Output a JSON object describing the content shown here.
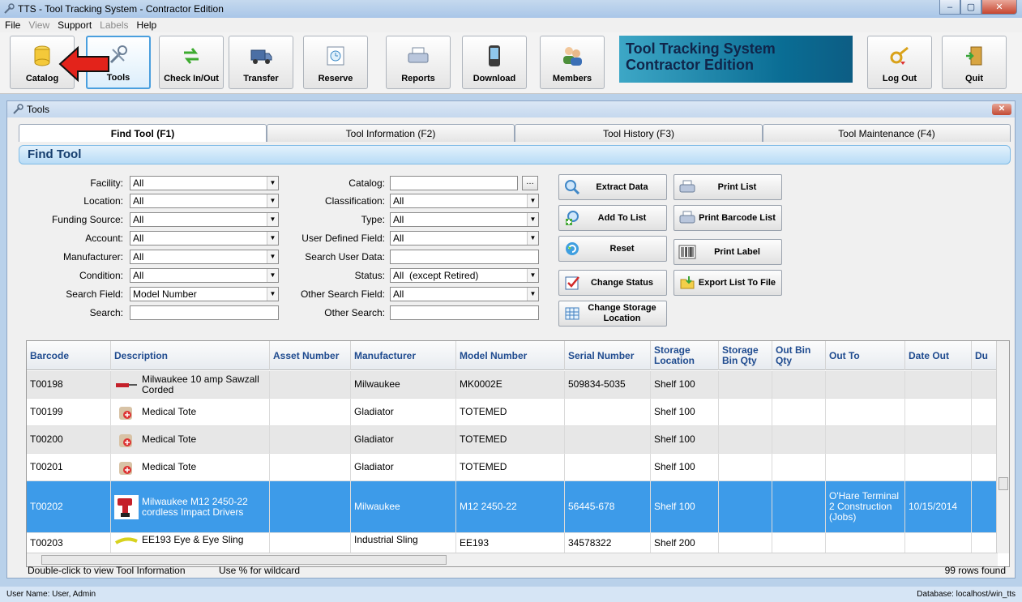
{
  "window": {
    "title": "TTS - Tool Tracking System - Contractor Edition",
    "minimize": "–",
    "maximize": "▢",
    "close": "✕"
  },
  "menu": [
    "File",
    "View",
    "Support",
    "Labels",
    "Help"
  ],
  "toolbar": {
    "buttons": [
      {
        "label": "Catalog",
        "icon": "catalog-icon"
      },
      {
        "label": "Tools",
        "icon": "tools-icon"
      },
      {
        "label": "Check In/Out",
        "icon": "check-inout-icon"
      },
      {
        "label": "Transfer",
        "icon": "transfer-icon"
      },
      {
        "label": "Reserve",
        "icon": "reserve-icon"
      },
      {
        "label": "Reports",
        "icon": "reports-icon"
      },
      {
        "label": "Download",
        "icon": "download-icon"
      },
      {
        "label": "Members",
        "icon": "members-icon"
      }
    ],
    "brand_line1": "Tool Tracking System",
    "brand_line2": "Contractor Edition",
    "logout": "Log Out",
    "quit": "Quit"
  },
  "tools_window": {
    "title": "Tools",
    "close": "✕",
    "tabs": [
      "Find Tool (F1)",
      "Tool Information (F2)",
      "Tool History (F3)",
      "Tool Maintenance (F4)"
    ],
    "section_title": "Find Tool"
  },
  "filters_left": [
    {
      "label": "Facility:",
      "value": "All"
    },
    {
      "label": "Location:",
      "value": "All"
    },
    {
      "label": "Funding Source:",
      "value": "All"
    },
    {
      "label": "Account:",
      "value": "All"
    },
    {
      "label": "Manufacturer:",
      "value": "All"
    },
    {
      "label": "Condition:",
      "value": "All"
    },
    {
      "label": "Search Field:",
      "value": "Model Number"
    },
    {
      "label": "Search:",
      "value": ""
    }
  ],
  "filters_right": [
    {
      "label": "Catalog:",
      "value": ""
    },
    {
      "label": "Classification:",
      "value": "All"
    },
    {
      "label": "Type:",
      "value": "All"
    },
    {
      "label": "User Defined Field:",
      "value": "All"
    },
    {
      "label": "Search User Data:",
      "value": ""
    },
    {
      "label": "Status:",
      "value": "All  (except Retired)"
    },
    {
      "label": "Other Search Field:",
      "value": "All"
    },
    {
      "label": "Other Search:",
      "value": ""
    }
  ],
  "actions_a": [
    {
      "label": "Extract Data",
      "icon": "magnifier-icon"
    },
    {
      "label": "Add To List",
      "icon": "add-list-icon"
    },
    {
      "label": "Reset",
      "icon": "refresh-icon"
    },
    {
      "label": "Change Status",
      "icon": "checkbox-icon"
    },
    {
      "label": "Change Storage Location",
      "icon": "grid-icon"
    }
  ],
  "actions_b": [
    {
      "label": "Print List",
      "icon": "printer-icon"
    },
    {
      "label": "Print Barcode List",
      "icon": "printer-icon"
    },
    {
      "label": "Print Label",
      "icon": "barcode-icon"
    },
    {
      "label": "Export List To File",
      "icon": "folder-arrow-icon"
    }
  ],
  "grid": {
    "columns": [
      "Barcode",
      "Description",
      "Asset Number",
      "Manufacturer",
      "Model Number",
      "Serial Number",
      "Storage Location",
      "Storage Bin Qty",
      "Out Bin Qty",
      "Out To",
      "Date Out",
      "Du"
    ],
    "rows": [
      {
        "barcode": "T00198",
        "description": "Milwaukee 10 amp Sawzall Corded",
        "asset": "",
        "manufacturer": "Milwaukee",
        "model": "MK0002E",
        "serial": "509834-5035",
        "storage": "Shelf 100",
        "bin_qty": "",
        "out_bin_qty": "",
        "out_to": "",
        "date_out": "",
        "thumb": "saw-thumb"
      },
      {
        "barcode": "T00199",
        "description": "Medical Tote",
        "asset": "",
        "manufacturer": "Gladiator",
        "model": "TOTEMED",
        "serial": "",
        "storage": "Shelf 100",
        "bin_qty": "",
        "out_bin_qty": "",
        "out_to": "",
        "date_out": "",
        "thumb": "medical-tote-thumb"
      },
      {
        "barcode": "T00200",
        "description": "Medical Tote",
        "asset": "",
        "manufacturer": "Gladiator",
        "model": "TOTEMED",
        "serial": "",
        "storage": "Shelf 100",
        "bin_qty": "",
        "out_bin_qty": "",
        "out_to": "",
        "date_out": "",
        "thumb": "medical-tote-thumb"
      },
      {
        "barcode": "T00201",
        "description": "Medical Tote",
        "asset": "",
        "manufacturer": "Gladiator",
        "model": "TOTEMED",
        "serial": "",
        "storage": "Shelf 100",
        "bin_qty": "",
        "out_bin_qty": "",
        "out_to": "",
        "date_out": "",
        "thumb": "medical-tote-thumb"
      },
      {
        "barcode": "T00202",
        "description": "Milwaukee M12 2450-22 cordless Impact Drivers",
        "asset": "",
        "manufacturer": "Milwaukee",
        "model": "M12 2450-22",
        "serial": "56445-678",
        "storage": "Shelf 100",
        "bin_qty": "",
        "out_bin_qty": "",
        "out_to": "O'Hare Terminal 2 Construction (Jobs)",
        "date_out": "10/15/2014",
        "thumb": "impact-driver-thumb"
      },
      {
        "barcode": "T00203",
        "description": "EE193 Eye & Eye Sling",
        "asset": "",
        "manufacturer": "Industrial Sling",
        "model": "EE193",
        "serial": "34578322",
        "storage": "Shelf 200",
        "bin_qty": "",
        "out_bin_qty": "",
        "out_to": "",
        "date_out": "",
        "thumb": "sling-thumb"
      }
    ]
  },
  "status": {
    "hint1": "Double-click to view Tool Information",
    "hint2": "Use % for wildcard",
    "rows_found": "99 rows found"
  },
  "footer": {
    "user": "User Name:  User, Admin",
    "database": "Database:  localhost/win_tts"
  },
  "colors": {
    "selected_row": "#3d9be9",
    "header_text": "#1f4b8f",
    "annotation_arrow": "#e3231b"
  }
}
